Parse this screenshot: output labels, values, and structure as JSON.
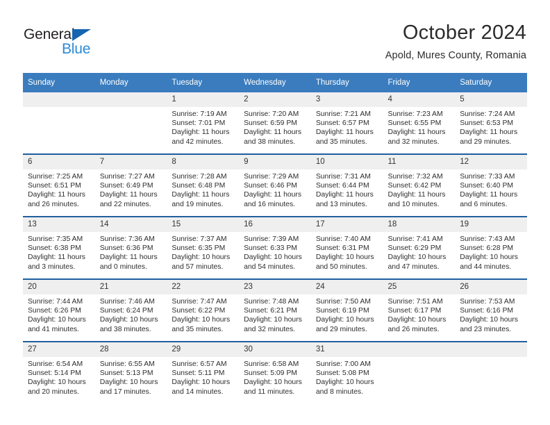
{
  "brand": {
    "name_part1": "General",
    "name_part2": "Blue",
    "accent_color": "#2b8ad6",
    "triangle_color": "#1565b0"
  },
  "header": {
    "month_title": "October 2024",
    "location": "Apold, Mures County, Romania"
  },
  "calendar": {
    "header_bg": "#3a7cbe",
    "row_divider": "#1f5fa0",
    "daynum_bg": "#efefef",
    "weekday_headers": [
      "Sunday",
      "Monday",
      "Tuesday",
      "Wednesday",
      "Thursday",
      "Friday",
      "Saturday"
    ],
    "weeks": [
      [
        {
          "day": "",
          "blank": true,
          "sunrise": "",
          "sunset": "",
          "daylight_line1": "",
          "daylight_line2": ""
        },
        {
          "day": "",
          "blank": true,
          "sunrise": "",
          "sunset": "",
          "daylight_line1": "",
          "daylight_line2": ""
        },
        {
          "day": "1",
          "sunrise": "Sunrise: 7:19 AM",
          "sunset": "Sunset: 7:01 PM",
          "daylight_line1": "Daylight: 11 hours",
          "daylight_line2": "and 42 minutes."
        },
        {
          "day": "2",
          "sunrise": "Sunrise: 7:20 AM",
          "sunset": "Sunset: 6:59 PM",
          "daylight_line1": "Daylight: 11 hours",
          "daylight_line2": "and 38 minutes."
        },
        {
          "day": "3",
          "sunrise": "Sunrise: 7:21 AM",
          "sunset": "Sunset: 6:57 PM",
          "daylight_line1": "Daylight: 11 hours",
          "daylight_line2": "and 35 minutes."
        },
        {
          "day": "4",
          "sunrise": "Sunrise: 7:23 AM",
          "sunset": "Sunset: 6:55 PM",
          "daylight_line1": "Daylight: 11 hours",
          "daylight_line2": "and 32 minutes."
        },
        {
          "day": "5",
          "sunrise": "Sunrise: 7:24 AM",
          "sunset": "Sunset: 6:53 PM",
          "daylight_line1": "Daylight: 11 hours",
          "daylight_line2": "and 29 minutes."
        }
      ],
      [
        {
          "day": "6",
          "sunrise": "Sunrise: 7:25 AM",
          "sunset": "Sunset: 6:51 PM",
          "daylight_line1": "Daylight: 11 hours",
          "daylight_line2": "and 26 minutes."
        },
        {
          "day": "7",
          "sunrise": "Sunrise: 7:27 AM",
          "sunset": "Sunset: 6:49 PM",
          "daylight_line1": "Daylight: 11 hours",
          "daylight_line2": "and 22 minutes."
        },
        {
          "day": "8",
          "sunrise": "Sunrise: 7:28 AM",
          "sunset": "Sunset: 6:48 PM",
          "daylight_line1": "Daylight: 11 hours",
          "daylight_line2": "and 19 minutes."
        },
        {
          "day": "9",
          "sunrise": "Sunrise: 7:29 AM",
          "sunset": "Sunset: 6:46 PM",
          "daylight_line1": "Daylight: 11 hours",
          "daylight_line2": "and 16 minutes."
        },
        {
          "day": "10",
          "sunrise": "Sunrise: 7:31 AM",
          "sunset": "Sunset: 6:44 PM",
          "daylight_line1": "Daylight: 11 hours",
          "daylight_line2": "and 13 minutes."
        },
        {
          "day": "11",
          "sunrise": "Sunrise: 7:32 AM",
          "sunset": "Sunset: 6:42 PM",
          "daylight_line1": "Daylight: 11 hours",
          "daylight_line2": "and 10 minutes."
        },
        {
          "day": "12",
          "sunrise": "Sunrise: 7:33 AM",
          "sunset": "Sunset: 6:40 PM",
          "daylight_line1": "Daylight: 11 hours",
          "daylight_line2": "and 6 minutes."
        }
      ],
      [
        {
          "day": "13",
          "sunrise": "Sunrise: 7:35 AM",
          "sunset": "Sunset: 6:38 PM",
          "daylight_line1": "Daylight: 11 hours",
          "daylight_line2": "and 3 minutes."
        },
        {
          "day": "14",
          "sunrise": "Sunrise: 7:36 AM",
          "sunset": "Sunset: 6:36 PM",
          "daylight_line1": "Daylight: 11 hours",
          "daylight_line2": "and 0 minutes."
        },
        {
          "day": "15",
          "sunrise": "Sunrise: 7:37 AM",
          "sunset": "Sunset: 6:35 PM",
          "daylight_line1": "Daylight: 10 hours",
          "daylight_line2": "and 57 minutes."
        },
        {
          "day": "16",
          "sunrise": "Sunrise: 7:39 AM",
          "sunset": "Sunset: 6:33 PM",
          "daylight_line1": "Daylight: 10 hours",
          "daylight_line2": "and 54 minutes."
        },
        {
          "day": "17",
          "sunrise": "Sunrise: 7:40 AM",
          "sunset": "Sunset: 6:31 PM",
          "daylight_line1": "Daylight: 10 hours",
          "daylight_line2": "and 50 minutes."
        },
        {
          "day": "18",
          "sunrise": "Sunrise: 7:41 AM",
          "sunset": "Sunset: 6:29 PM",
          "daylight_line1": "Daylight: 10 hours",
          "daylight_line2": "and 47 minutes."
        },
        {
          "day": "19",
          "sunrise": "Sunrise: 7:43 AM",
          "sunset": "Sunset: 6:28 PM",
          "daylight_line1": "Daylight: 10 hours",
          "daylight_line2": "and 44 minutes."
        }
      ],
      [
        {
          "day": "20",
          "sunrise": "Sunrise: 7:44 AM",
          "sunset": "Sunset: 6:26 PM",
          "daylight_line1": "Daylight: 10 hours",
          "daylight_line2": "and 41 minutes."
        },
        {
          "day": "21",
          "sunrise": "Sunrise: 7:46 AM",
          "sunset": "Sunset: 6:24 PM",
          "daylight_line1": "Daylight: 10 hours",
          "daylight_line2": "and 38 minutes."
        },
        {
          "day": "22",
          "sunrise": "Sunrise: 7:47 AM",
          "sunset": "Sunset: 6:22 PM",
          "daylight_line1": "Daylight: 10 hours",
          "daylight_line2": "and 35 minutes."
        },
        {
          "day": "23",
          "sunrise": "Sunrise: 7:48 AM",
          "sunset": "Sunset: 6:21 PM",
          "daylight_line1": "Daylight: 10 hours",
          "daylight_line2": "and 32 minutes."
        },
        {
          "day": "24",
          "sunrise": "Sunrise: 7:50 AM",
          "sunset": "Sunset: 6:19 PM",
          "daylight_line1": "Daylight: 10 hours",
          "daylight_line2": "and 29 minutes."
        },
        {
          "day": "25",
          "sunrise": "Sunrise: 7:51 AM",
          "sunset": "Sunset: 6:17 PM",
          "daylight_line1": "Daylight: 10 hours",
          "daylight_line2": "and 26 minutes."
        },
        {
          "day": "26",
          "sunrise": "Sunrise: 7:53 AM",
          "sunset": "Sunset: 6:16 PM",
          "daylight_line1": "Daylight: 10 hours",
          "daylight_line2": "and 23 minutes."
        }
      ],
      [
        {
          "day": "27",
          "sunrise": "Sunrise: 6:54 AM",
          "sunset": "Sunset: 5:14 PM",
          "daylight_line1": "Daylight: 10 hours",
          "daylight_line2": "and 20 minutes."
        },
        {
          "day": "28",
          "sunrise": "Sunrise: 6:55 AM",
          "sunset": "Sunset: 5:13 PM",
          "daylight_line1": "Daylight: 10 hours",
          "daylight_line2": "and 17 minutes."
        },
        {
          "day": "29",
          "sunrise": "Sunrise: 6:57 AM",
          "sunset": "Sunset: 5:11 PM",
          "daylight_line1": "Daylight: 10 hours",
          "daylight_line2": "and 14 minutes."
        },
        {
          "day": "30",
          "sunrise": "Sunrise: 6:58 AM",
          "sunset": "Sunset: 5:09 PM",
          "daylight_line1": "Daylight: 10 hours",
          "daylight_line2": "and 11 minutes."
        },
        {
          "day": "31",
          "sunrise": "Sunrise: 7:00 AM",
          "sunset": "Sunset: 5:08 PM",
          "daylight_line1": "Daylight: 10 hours",
          "daylight_line2": "and 8 minutes."
        },
        {
          "day": "",
          "blank": true,
          "sunrise": "",
          "sunset": "",
          "daylight_line1": "",
          "daylight_line2": ""
        },
        {
          "day": "",
          "blank": true,
          "sunrise": "",
          "sunset": "",
          "daylight_line1": "",
          "daylight_line2": ""
        }
      ]
    ]
  }
}
